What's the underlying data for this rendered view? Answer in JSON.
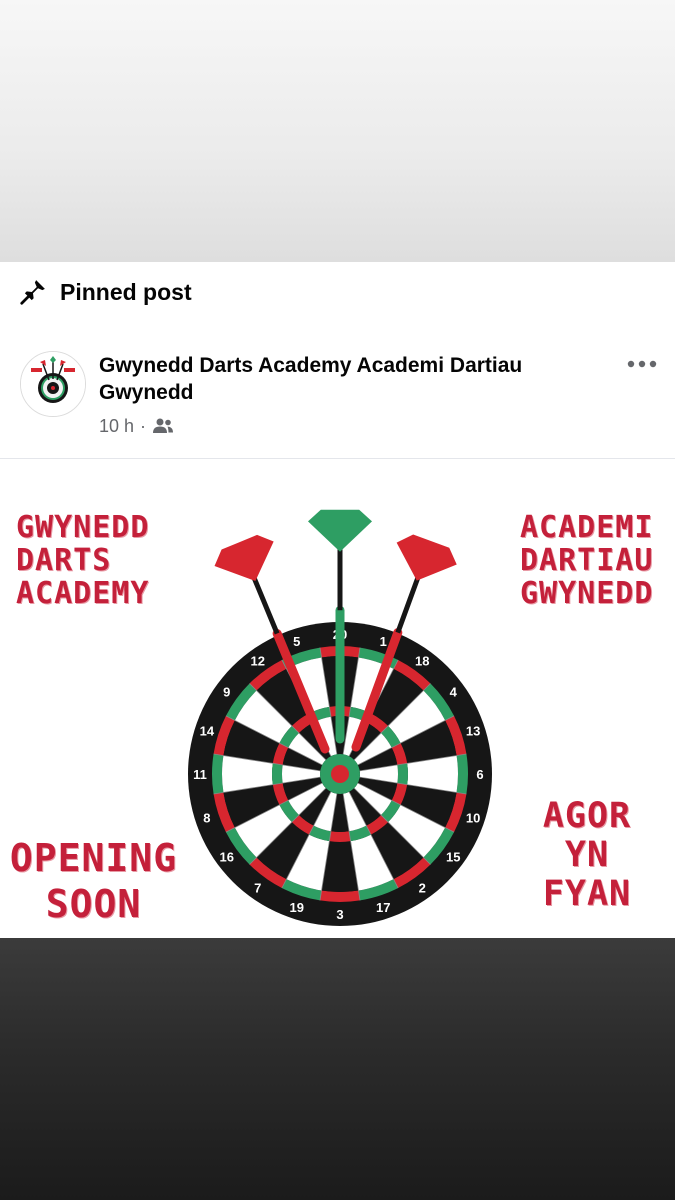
{
  "pinned": {
    "label": "Pinned post",
    "icon": "pin-icon"
  },
  "post": {
    "page_name": "Gwynedd Darts Academy Academi Dartiau Gwynedd",
    "time": "10 h",
    "separator": "·",
    "audience_icon": "friends-icon",
    "more_icon": "more-options-icon"
  },
  "image": {
    "text_left": [
      "GWYNEDD",
      "DARTS",
      "ACADEMY"
    ],
    "text_right": [
      "ACADEMI",
      "DARTIAU",
      "GWYNEDD"
    ],
    "text_opening": [
      "OPENING",
      "SOON"
    ],
    "text_agor": [
      "AGOR",
      "YN",
      "FYAN"
    ],
    "board_numbers": [
      "20",
      "1",
      "18",
      "4",
      "13",
      "6",
      "10",
      "15",
      "2",
      "17",
      "3",
      "19",
      "7",
      "16",
      "8",
      "11",
      "14",
      "9",
      "12",
      "5"
    ],
    "colors": {
      "red": "#d7262f",
      "green": "#2e9e63",
      "black": "#161616",
      "cream": "#ffffff",
      "text_red": "#c4203a"
    }
  }
}
